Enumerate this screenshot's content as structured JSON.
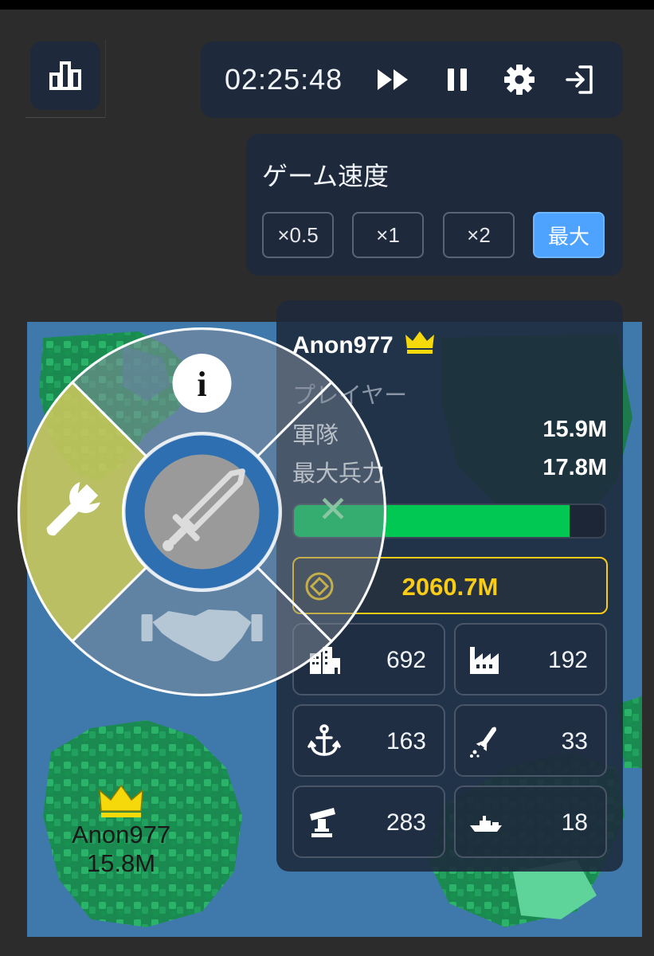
{
  "header": {
    "timer": "02:25:48",
    "icons": [
      "stats-icon",
      "fast-forward-icon",
      "pause-icon",
      "gear-icon",
      "exit-icon"
    ]
  },
  "speed_menu": {
    "title": "ゲーム速度",
    "options": [
      "×0.5",
      "×1",
      "×2",
      "最大"
    ],
    "selected": "最大"
  },
  "radial_menu": {
    "items": [
      "info-icon",
      "wrench-icon",
      "sword-icon",
      "close-icon",
      "handshake-icon"
    ],
    "info_glyph": "i",
    "close_glyph": "✕"
  },
  "player": {
    "name": "Anon977",
    "type": "プレイヤー",
    "troops_label": "軍隊",
    "troops": "15.9M",
    "max_label": "最大兵力",
    "max_troops": "17.8M",
    "troop_fraction": 0.888,
    "gold": "2060.7M",
    "stats": [
      {
        "icon": "city-icon",
        "value": "692"
      },
      {
        "icon": "factory-icon",
        "value": "192"
      },
      {
        "icon": "anchor-icon",
        "value": "163"
      },
      {
        "icon": "missile-icon",
        "value": "33"
      },
      {
        "icon": "sam-launcher-icon",
        "value": "283"
      },
      {
        "icon": "warship-icon",
        "value": "18"
      }
    ]
  },
  "map_label": {
    "name": "Anon977",
    "troops": "15.8M"
  },
  "colors": {
    "panel": "#1e293b",
    "accent_blue": "#4da3ff",
    "troop_green": "#00c853",
    "gold": "#facc15",
    "ocean": "#3f79ac",
    "land": "#1f9a5a",
    "radial_selected": "#c4c45a"
  }
}
